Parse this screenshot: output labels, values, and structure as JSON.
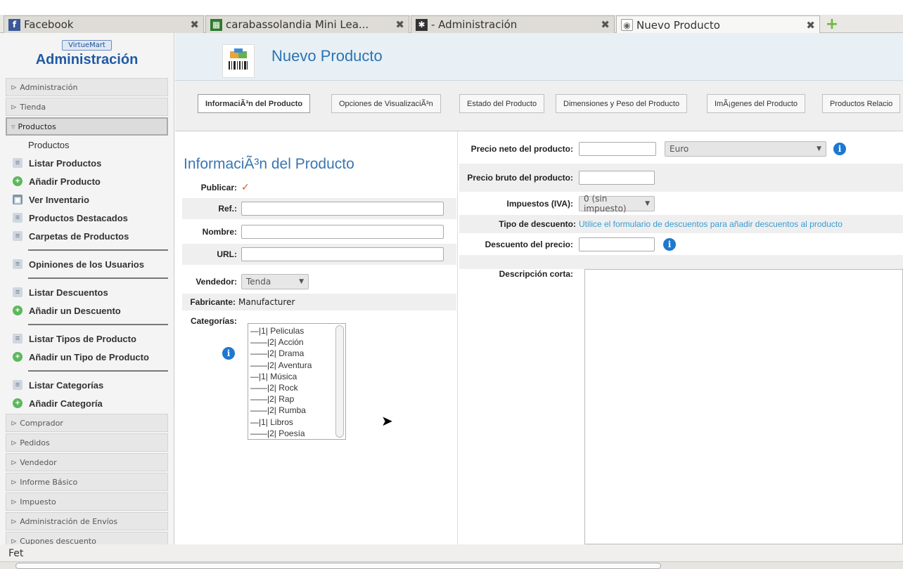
{
  "browser": {
    "tabs": [
      {
        "title": "Facebook",
        "icon": "facebook-icon",
        "close": "✖"
      },
      {
        "title": "carabassolandia Mini Lea...",
        "icon": "site-icon",
        "close": "✖"
      },
      {
        "title": "- Administración",
        "icon": "joomla-icon",
        "close": "✖"
      },
      {
        "title": "Nuevo Producto",
        "icon": "page-icon",
        "close": "✖"
      }
    ],
    "new_tab": "+"
  },
  "sidebar": {
    "logo_top": "VirtueMart",
    "logo_title": "Administración",
    "sections_top": [
      "Administración",
      "Tienda"
    ],
    "open_section": "Productos",
    "items": [
      {
        "label": "Productos",
        "icon": ""
      },
      {
        "label": "Listar Productos",
        "icon": "doc"
      },
      {
        "label": "Añadir Producto",
        "icon": "add"
      },
      {
        "label": "Ver Inventario",
        "icon": "inv"
      },
      {
        "label": "Productos Destacados",
        "icon": "doc"
      },
      {
        "label": "Carpetas de Productos",
        "icon": "doc"
      },
      {
        "label": "Opiniones de los Usuarios",
        "icon": "doc"
      },
      {
        "label": "Listar Descuentos",
        "icon": "doc"
      },
      {
        "label": "Añadir un Descuento",
        "icon": "add"
      },
      {
        "label": "Listar Tipos de Producto",
        "icon": "doc"
      },
      {
        "label": "Añadir un Tipo de Producto",
        "icon": "add"
      },
      {
        "label": "Listar Categorías",
        "icon": "doc"
      },
      {
        "label": "Añadir Categoría",
        "icon": "add"
      }
    ],
    "sections_bottom": [
      "Comprador",
      "Pedidos",
      "Vendedor",
      "Informe Básico",
      "Impuesto",
      "Administración de Envíos",
      "Cupones descuento"
    ]
  },
  "header": {
    "title": "Nuevo Producto"
  },
  "product_tabs": [
    "InformaciÃ³n del Producto",
    "Opciones de VisualizaciÃ³n",
    "Estado del Producto",
    "Dimensiones y Peso del Producto",
    "ImÃ¡genes del Producto",
    "Productos Relacio"
  ],
  "form": {
    "heading": "InformaciÃ³n del Producto",
    "publicar_label": "Publicar:",
    "publicar_checked": "✓",
    "ref_label": "Ref.:",
    "nombre_label": "Nombre:",
    "url_label": "URL:",
    "vendedor_label": "Vendedor:",
    "vendedor_value": "Tenda",
    "fabricante_label": "Fabricante:",
    "fabricante_value": "Manufacturer",
    "categorias_label": "Categorías:",
    "categories": [
      "—|1| Peliculas",
      "——|2| Acción",
      "——|2| Drama",
      "——|2| Aventura",
      "—|1| Música",
      "——|2| Rock",
      "——|2| Rap",
      "——|2| Rumba",
      "—|1| Libros",
      "——|2| Poesía"
    ]
  },
  "pricing": {
    "neto_label": "Precio neto del producto:",
    "currency": "Euro",
    "bruto_label": "Precio bruto del producto:",
    "impuestos_label": "Impuestos (IVA):",
    "impuestos_value": "0 (sin impuesto)",
    "tipo_desc_label": "Tipo de descuento:",
    "tipo_desc_link": "Utilice el formulario de descuentos para añadir descuentos al producto",
    "descuento_label": "Descuento del precio:",
    "desc_corta_label": "Descripción corta:"
  },
  "status_bar": "Fet"
}
